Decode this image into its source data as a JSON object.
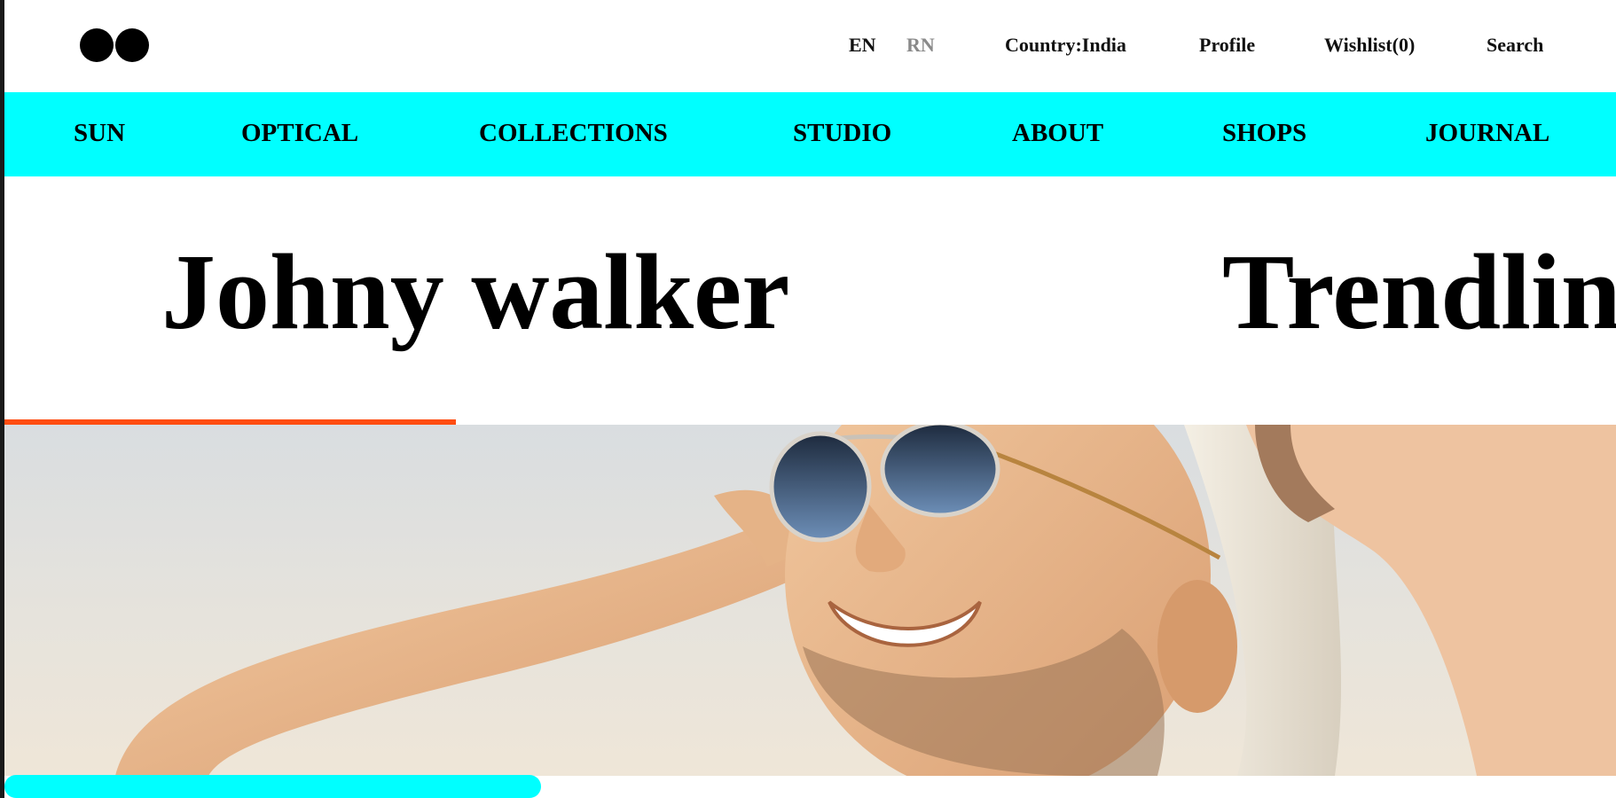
{
  "colors": {
    "nav_background": "#00ffff",
    "progress_accent": "#ff4d12",
    "text": "#000000",
    "inactive_language": "#8a8a8a"
  },
  "header": {
    "logo_icon": "two-dots-logo",
    "languages": [
      "EN",
      "RN"
    ],
    "active_language": "EN",
    "country_label": "Country:India",
    "profile_label": "Profile",
    "wishlist_label": "Wishlist(0)",
    "search_label": "Search"
  },
  "nav": {
    "items": [
      "SUN",
      "OPTICAL",
      "COLLECTIONS",
      "STUDIO",
      "ABOUT",
      "SHOPS",
      "JOURNAL"
    ]
  },
  "slider": {
    "titles": [
      "Johny walker",
      "Trendlin"
    ],
    "progress": 0.28
  },
  "hero": {
    "image": "smiling man wearing aviator sunglasses and a straw hat, arm raised behind head, bright sky background"
  }
}
